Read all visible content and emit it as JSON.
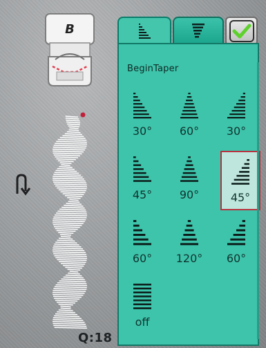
{
  "presser_foot": {
    "letter": "B",
    "icon": "presser-foot-icon"
  },
  "stitch_preview": {
    "icon": "stitch-preview"
  },
  "reverse_icon": "reverse-stitch-icon",
  "quantity_label": "Q:18",
  "tabs": [
    {
      "name": "taper-begin-tab",
      "icon": "taper-begin-icon",
      "active": true
    },
    {
      "name": "taper-end-tab",
      "icon": "taper-end-icon",
      "active": false
    }
  ],
  "ok_button": {
    "icon": "checkmark-icon"
  },
  "panel": {
    "title": "BeginTaper",
    "options": [
      {
        "label": "30°",
        "glyph": "taper-left-30"
      },
      {
        "label": "60°",
        "glyph": "taper-center-60"
      },
      {
        "label": "30°",
        "glyph": "taper-right-30"
      },
      {
        "label": "45°",
        "glyph": "taper-left-45"
      },
      {
        "label": "90°",
        "glyph": "taper-center-90"
      },
      {
        "label": "45°",
        "glyph": "taper-right-45",
        "selected": true
      },
      {
        "label": "60°",
        "glyph": "taper-left-60"
      },
      {
        "label": "120°",
        "glyph": "taper-center-120"
      },
      {
        "label": "60°",
        "glyph": "taper-right-60"
      },
      {
        "label": "off",
        "glyph": "taper-off"
      }
    ]
  },
  "colors": {
    "panel": "#3ec4ab",
    "tab": "#1aa58d",
    "selected_border": "#b8313e",
    "checkmark": "#5ed12c"
  }
}
